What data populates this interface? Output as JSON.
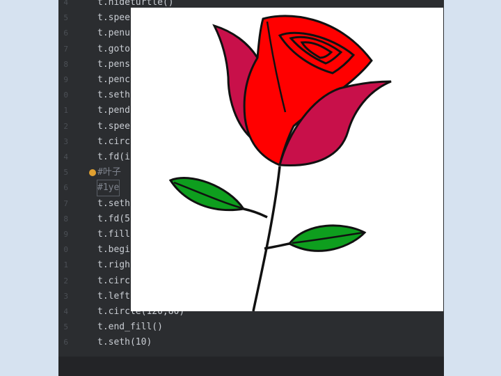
{
  "gutter": {
    "lines": [
      "4",
      "5",
      "6",
      "7",
      "8",
      "9",
      "0",
      "1",
      "2",
      "3",
      "4",
      "5",
      "6",
      "7",
      "8",
      "9",
      "0",
      "1",
      "2",
      "3",
      "4",
      "5",
      "6"
    ]
  },
  "code": {
    "lines": [
      "t.hideturtle()",
      "t.spee",
      "t.penu",
      "t.goto",
      "t.pens",
      "t.penc",
      "t.seth",
      "t.pend",
      "t.spee",
      "t.circ",
      "t.fd(i",
      "#叶子",
      "#1ye",
      "t.seth",
      "t.fd(5",
      "t.fill",
      "t.begi",
      "t.righ",
      "t.circ",
      "t.left",
      "t.circle(120,80)",
      "t.end_fill()",
      "t.seth(10)"
    ]
  },
  "drawing": {
    "colors": {
      "petal_red": "#ff0000",
      "petal_crimson": "#c8104a",
      "leaf_green": "#0e9e1e",
      "outline": "#111111"
    }
  }
}
